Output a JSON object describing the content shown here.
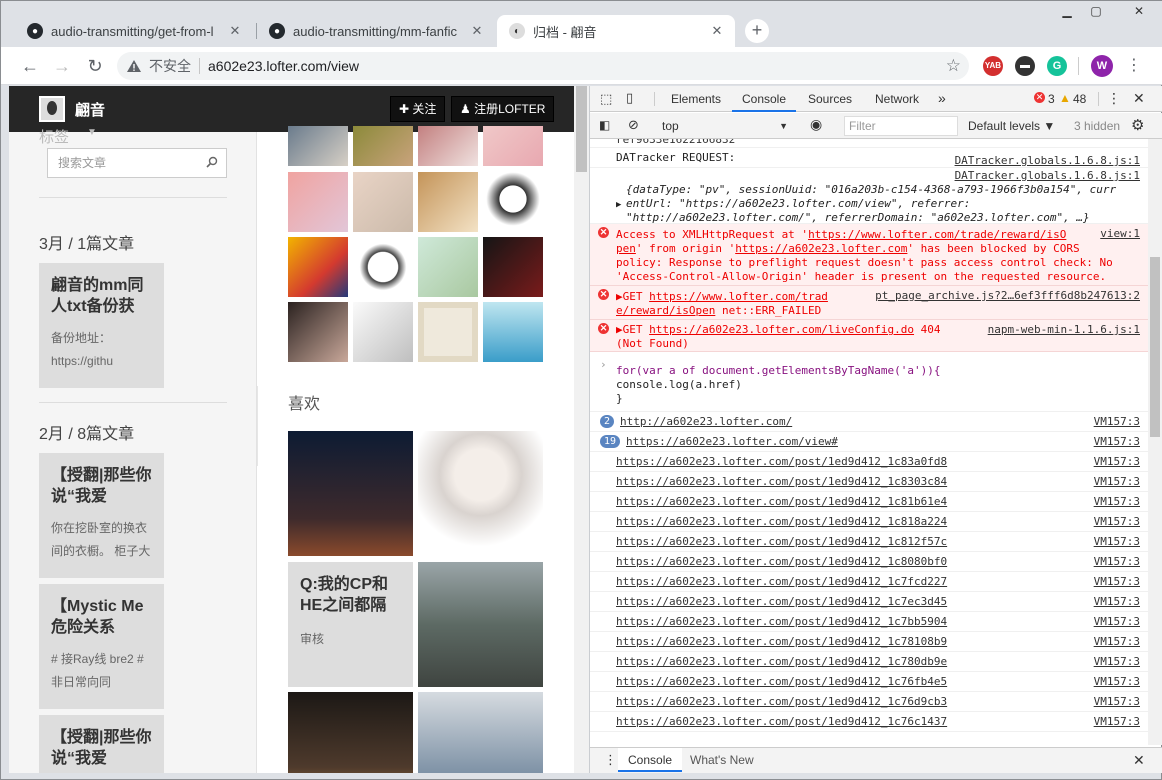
{
  "browser": {
    "tabs": [
      {
        "title": "audio-transmitting/get-from-l",
        "icon": "github-icon"
      },
      {
        "title": "audio-transmitting/mm-fanfic",
        "icon": "github-icon"
      },
      {
        "title": "归档 - 翩音",
        "icon": "lofter-avatar-icon"
      }
    ],
    "url_security": "不安全",
    "url": "a602e23.lofter.com/view",
    "extensions": [
      "YAB",
      "mask",
      "G",
      "W"
    ]
  },
  "blog": {
    "name": "翩音",
    "follow_label": "关注",
    "register_label": "注册LOFTER",
    "tag_title": "标签",
    "search_placeholder": "搜索文章",
    "months": [
      {
        "label": "3月 / 1篇文章"
      },
      {
        "label": "2月 / 8篇文章"
      }
    ],
    "cards": [
      {
        "title": "翩音的mm同人txt备份获",
        "desc": "备份地址：https://githu"
      },
      {
        "title": "【授翻|那些你说“我爱",
        "desc": "你在挖卧室的换衣间的衣橱。 柜子大"
      },
      {
        "title": "【Mystic Me危险关系",
        "desc": "# 接Ray线 bre2 # 非日常向同"
      },
      {
        "title": "【授翻|那些你说“我爱",
        "desc": ""
      }
    ],
    "likes_label": "喜欢",
    "qa_card": {
      "title": "Q:我的CP和HE之间都隔",
      "desc": "审核"
    }
  },
  "devtools": {
    "tabs": [
      "Elements",
      "Console",
      "Sources",
      "Network"
    ],
    "active_tab": "Console",
    "errors": "3",
    "warnings": "48",
    "context": "top",
    "filter_placeholder": "Filter",
    "levels": "Default levels",
    "hidden": "3 hidden",
    "drawer_tabs": [
      "Console",
      "What's New"
    ],
    "log": {
      "top_clip": "ref9633e1622166832",
      "dt_label": "DATracker REQUEST:",
      "dt_src": "DATracker.globals.1.6.8.js:1",
      "dt_src2": "DATracker.globals.1.6.8.js:1",
      "obj_line1": "{dataType: \"pv\", sessionUuid: \"016a203b-c154-4368-a793-1966f3b0a154\", curr",
      "obj_line2": "entUrl: \"https://a602e23.lofter.com/view\", referrer:",
      "obj_line3": "\"http://a602e23.lofter.com/\", referrerDomain: \"a602e23.lofter.com\", …}",
      "err1_a": "Access to XMLHttpRequest at '",
      "err1_url": "https://www.lofter.com/trade/reward/isO",
      "err1_src": "view:1",
      "err1_b": "pen",
      "err1_c": "' from origin '",
      "err1_origin": "https://a602e23.lofter.com",
      "err1_d": "' has been blocked by CORS",
      "err1_e": "policy: Response to preflight request doesn't pass access control check: No",
      "err1_f": "'Access-Control-Allow-Origin' header is present on the requested resource.",
      "err2_get": "▶GET",
      "err2_url": "https://www.lofter.com/trad",
      "err2_src": "pt_page_archive.js?2…6ef3fff6d8b247613:2",
      "err2_b": "e/reward/isOpen",
      "err2_c": "net::ERR_FAILED",
      "err3_get": "▶GET",
      "err3_url": "https://a602e23.lofter.com/liveConfig.do",
      "err3_code": "404",
      "err3_src": "napm-web-min-1.1.6.js:1",
      "err3_b": "(Not Found)",
      "code1": "for(var a of document.getElementsByTagName('a')){",
      "code2": "console.log(a.href)",
      "code3": "}",
      "vm": "VM157:3",
      "grouped": [
        {
          "count": "2",
          "url": "http://a602e23.lofter.com/"
        },
        {
          "count": "19",
          "url": "https://a602e23.lofter.com/view#"
        }
      ],
      "posts": [
        "https://a602e23.lofter.com/post/1ed9d412_1c83a0fd8",
        "https://a602e23.lofter.com/post/1ed9d412_1c8303c84",
        "https://a602e23.lofter.com/post/1ed9d412_1c81b61e4",
        "https://a602e23.lofter.com/post/1ed9d412_1c818a224",
        "https://a602e23.lofter.com/post/1ed9d412_1c812f57c",
        "https://a602e23.lofter.com/post/1ed9d412_1c8080bf0",
        "https://a602e23.lofter.com/post/1ed9d412_1c7fcd227",
        "https://a602e23.lofter.com/post/1ed9d412_1c7ec3d45",
        "https://a602e23.lofter.com/post/1ed9d412_1c7bb5904",
        "https://a602e23.lofter.com/post/1ed9d412_1c78108b9",
        "https://a602e23.lofter.com/post/1ed9d412_1c780db9e",
        "https://a602e23.lofter.com/post/1ed9d412_1c76fb4e5",
        "https://a602e23.lofter.com/post/1ed9d412_1c76d9cb3",
        "https://a602e23.lofter.com/post/1ed9d412_1c76c1437"
      ]
    }
  },
  "colors": {
    "accent": "#1a73e8",
    "error_bg": "#fff0f0",
    "error_text": "#ee0000"
  }
}
